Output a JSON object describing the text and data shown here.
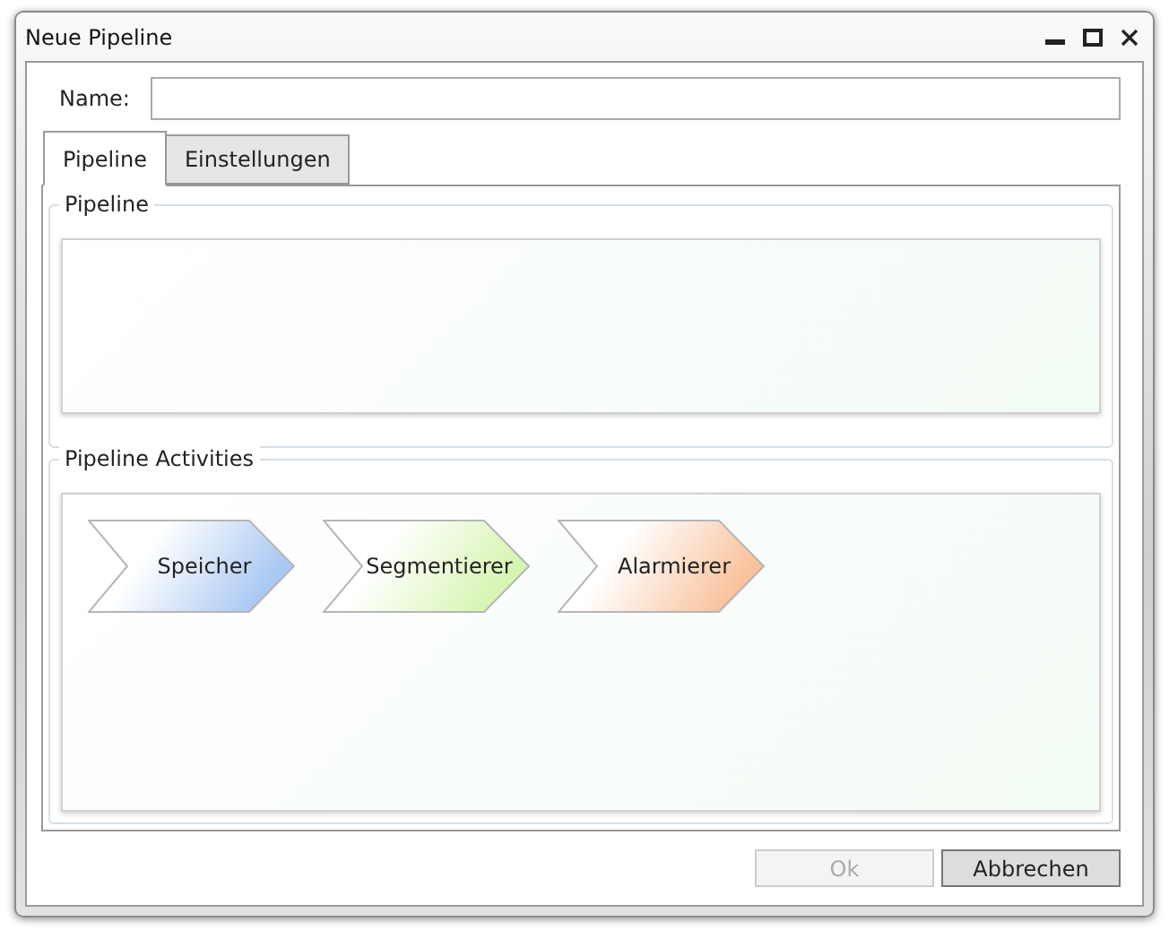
{
  "window": {
    "title": "Neue Pipeline"
  },
  "name_field": {
    "label": "Name:"
  },
  "tabs": [
    {
      "label": "Pipeline",
      "selected": true
    },
    {
      "label": "Einstellungen",
      "selected": false
    }
  ],
  "pipeline_group": {
    "title": "Pipeline"
  },
  "activities_group": {
    "title": "Pipeline Activities",
    "activities": [
      {
        "label": "Speicher",
        "color": "#a9c8f2"
      },
      {
        "label": "Segmentierer",
        "color": "#d6f5b0"
      },
      {
        "label": "Alarmierer",
        "color": "#f9c29c"
      }
    ]
  },
  "buttons": [
    {
      "label": "Ok",
      "disabled": true
    },
    {
      "label": "Abbrechen",
      "disabled": false
    }
  ]
}
